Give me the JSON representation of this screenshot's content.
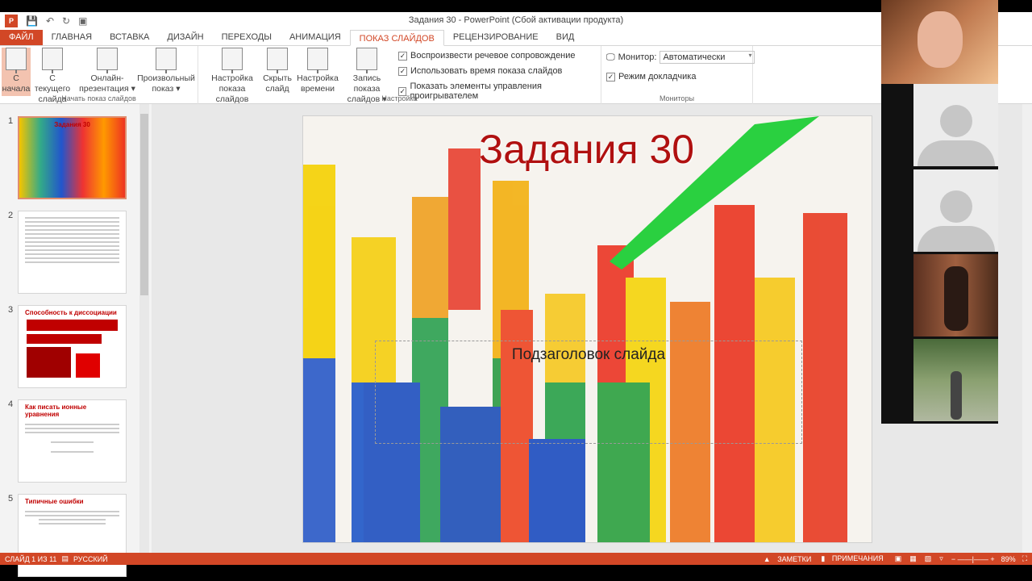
{
  "window": {
    "title": "Задания 30 - PowerPoint (Сбой активации продукта)"
  },
  "tabs": [
    "ФАЙЛ",
    "ГЛАВНАЯ",
    "ВСТАВКА",
    "ДИЗАЙН",
    "ПЕРЕХОДЫ",
    "АНИМАЦИЯ",
    "ПОКАЗ СЛАЙДОВ",
    "РЕЦЕНЗИРОВАНИЕ",
    "ВИД"
  ],
  "ribbon": {
    "start": {
      "label": "Начать показ слайдов",
      "from_start": "С начала",
      "from_current": "С текущего слайда",
      "online": "Онлайн-презентация ▾",
      "custom": "Произвольный показ ▾"
    },
    "setup": {
      "label": "Настройка",
      "setup_show": "Настройка показа слайдов",
      "hide": "Скрыть слайд",
      "timing": "Настройка времени",
      "record": "Запись показа слайдов ▾",
      "chk1": "Воспроизвести речевое сопровождение",
      "chk2": "Использовать время показа слайдов",
      "chk3": "Показать элементы управления проигрывателем"
    },
    "monitors": {
      "label": "Мониторы",
      "monitor_label": "Монитор:",
      "monitor_value": "Автоматически",
      "presenter": "Режим докладчика"
    }
  },
  "thumbnails": [
    {
      "num": "1",
      "title": "Задания 30"
    },
    {
      "num": "2",
      "title": ""
    },
    {
      "num": "3",
      "title": "Способность к диссоциации"
    },
    {
      "num": "4",
      "title": "Как писать ионные уравнения"
    },
    {
      "num": "5",
      "title": "Типичные ошибки"
    }
  ],
  "slide": {
    "title": "Задания 30",
    "subtitle": "Подзаголовок слайда"
  },
  "status": {
    "slide": "СЛАЙД 1 ИЗ 11",
    "lang": "РУССКИЙ",
    "notes": "ЗАМЕТКИ",
    "comments": "ПРИМЕЧАНИЯ",
    "zoom": "89%"
  }
}
